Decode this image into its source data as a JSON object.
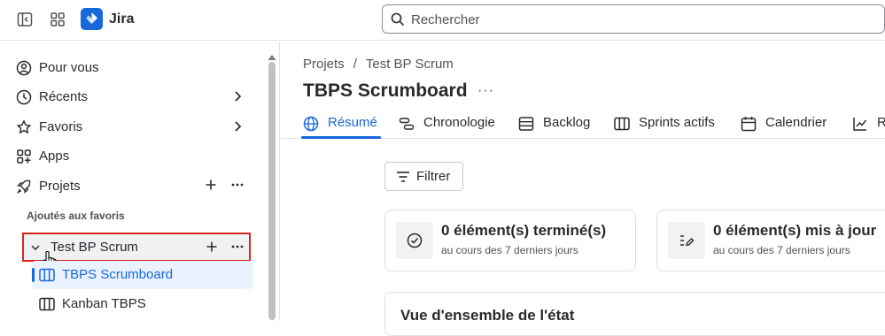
{
  "app": {
    "name": "Jira"
  },
  "search": {
    "placeholder": "Rechercher"
  },
  "sidebar": {
    "items": [
      {
        "label": "Pour vous"
      },
      {
        "label": "Récents"
      },
      {
        "label": "Favoris"
      },
      {
        "label": "Apps"
      },
      {
        "label": "Projets"
      }
    ],
    "section_label": "Ajoutés aux favoris",
    "favorite_project": "Test BP Scrum",
    "boards": [
      {
        "label": "TBPS Scrumboard"
      },
      {
        "label": "Kanban TBPS"
      }
    ]
  },
  "main": {
    "breadcrumb": {
      "root": "Projets",
      "separator": "/",
      "project": "Test BP Scrum"
    },
    "title": "TBPS Scrumboard",
    "title_more": "···",
    "tabs": [
      {
        "label": "Résumé"
      },
      {
        "label": "Chronologie"
      },
      {
        "label": "Backlog"
      },
      {
        "label": "Sprints actifs"
      },
      {
        "label": "Calendrier"
      },
      {
        "label": "Ra"
      }
    ],
    "filter_label": "Filtrer",
    "cards": [
      {
        "title": "0 élément(s) terminé(s)",
        "subtitle": "au cours des 7 derniers jours"
      },
      {
        "title": "0 élément(s) mis à jour",
        "subtitle": "au cours des 7 derniers jours"
      }
    ],
    "overview_title": "Vue d'ensemble de l'état"
  },
  "colors": {
    "accent": "#1868db",
    "highlight_border": "#d9261c",
    "text": "#292a2e",
    "muted": "#505258"
  }
}
